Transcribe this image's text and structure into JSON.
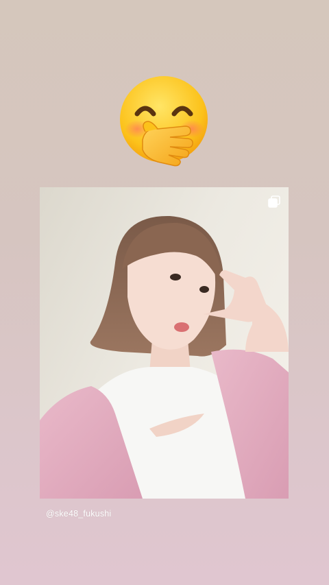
{
  "story": {
    "sticker": {
      "icon": "hand-over-mouth-emoji-icon"
    },
    "post": {
      "multi_photo_icon": "carousel-icon",
      "username": "@ske48_fukushi"
    }
  },
  "colors": {
    "background_top": "#d5c7bc",
    "background_bottom": "#e0c6d0",
    "jacket_pink": "#e6b1c4"
  }
}
